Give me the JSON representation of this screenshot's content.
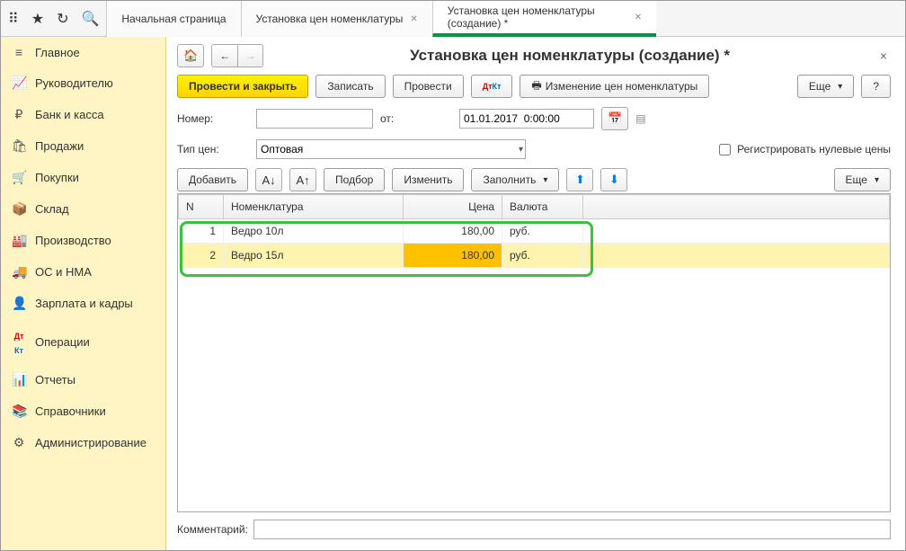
{
  "top_tabs": [
    {
      "label": "Начальная страница",
      "closable": false,
      "active": false
    },
    {
      "label": "Установка цен номенклатуры",
      "closable": true,
      "active": false
    },
    {
      "label": "Установка цен номенклатуры (создание) *",
      "closable": true,
      "active": true
    }
  ],
  "sidebar": {
    "items": [
      {
        "icon": "≡",
        "label": "Главное"
      },
      {
        "icon": "📈",
        "label": "Руководителю"
      },
      {
        "icon": "₽",
        "label": "Банк и касса"
      },
      {
        "icon": "🛍",
        "label": "Продажи"
      },
      {
        "icon": "🛒",
        "label": "Покупки"
      },
      {
        "icon": "📦",
        "label": "Склад"
      },
      {
        "icon": "🏭",
        "label": "Производство"
      },
      {
        "icon": "🚚",
        "label": "ОС и НМА"
      },
      {
        "icon": "👤",
        "label": "Зарплата и кадры"
      },
      {
        "icon": "Дт",
        "label": "Операции"
      },
      {
        "icon": "📊",
        "label": "Отчеты"
      },
      {
        "icon": "📚",
        "label": "Справочники"
      },
      {
        "icon": "⚙",
        "label": "Администрирование"
      }
    ]
  },
  "page": {
    "title": "Установка цен номенклатуры (создание) *",
    "buttons": {
      "post_close": "Провести и закрыть",
      "write": "Записать",
      "post": "Провести",
      "price_change": "Изменение цен номенклатуры",
      "more": "Еще",
      "help": "?"
    },
    "form": {
      "number_label": "Номер:",
      "number_value": "",
      "date_label": "от:",
      "date_value": "01.01.2017  0:00:00",
      "price_type_label": "Тип цен:",
      "price_type_value": "Оптовая",
      "register_zero_label": "Регистрировать нулевые цены"
    },
    "table_toolbar": {
      "add": "Добавить",
      "pick": "Подбор",
      "change": "Изменить",
      "fill": "Заполнить",
      "more": "Еще"
    },
    "table": {
      "headers": {
        "n": "N",
        "nom": "Номенклатура",
        "price": "Цена",
        "currency": "Валюта"
      },
      "rows": [
        {
          "n": "1",
          "nom": "Ведро 10л",
          "price": "180,00",
          "currency": "руб."
        },
        {
          "n": "2",
          "nom": "Ведро 15л",
          "price": "180,00",
          "currency": "руб."
        }
      ]
    },
    "comment_label": "Комментарий:",
    "comment_value": ""
  }
}
